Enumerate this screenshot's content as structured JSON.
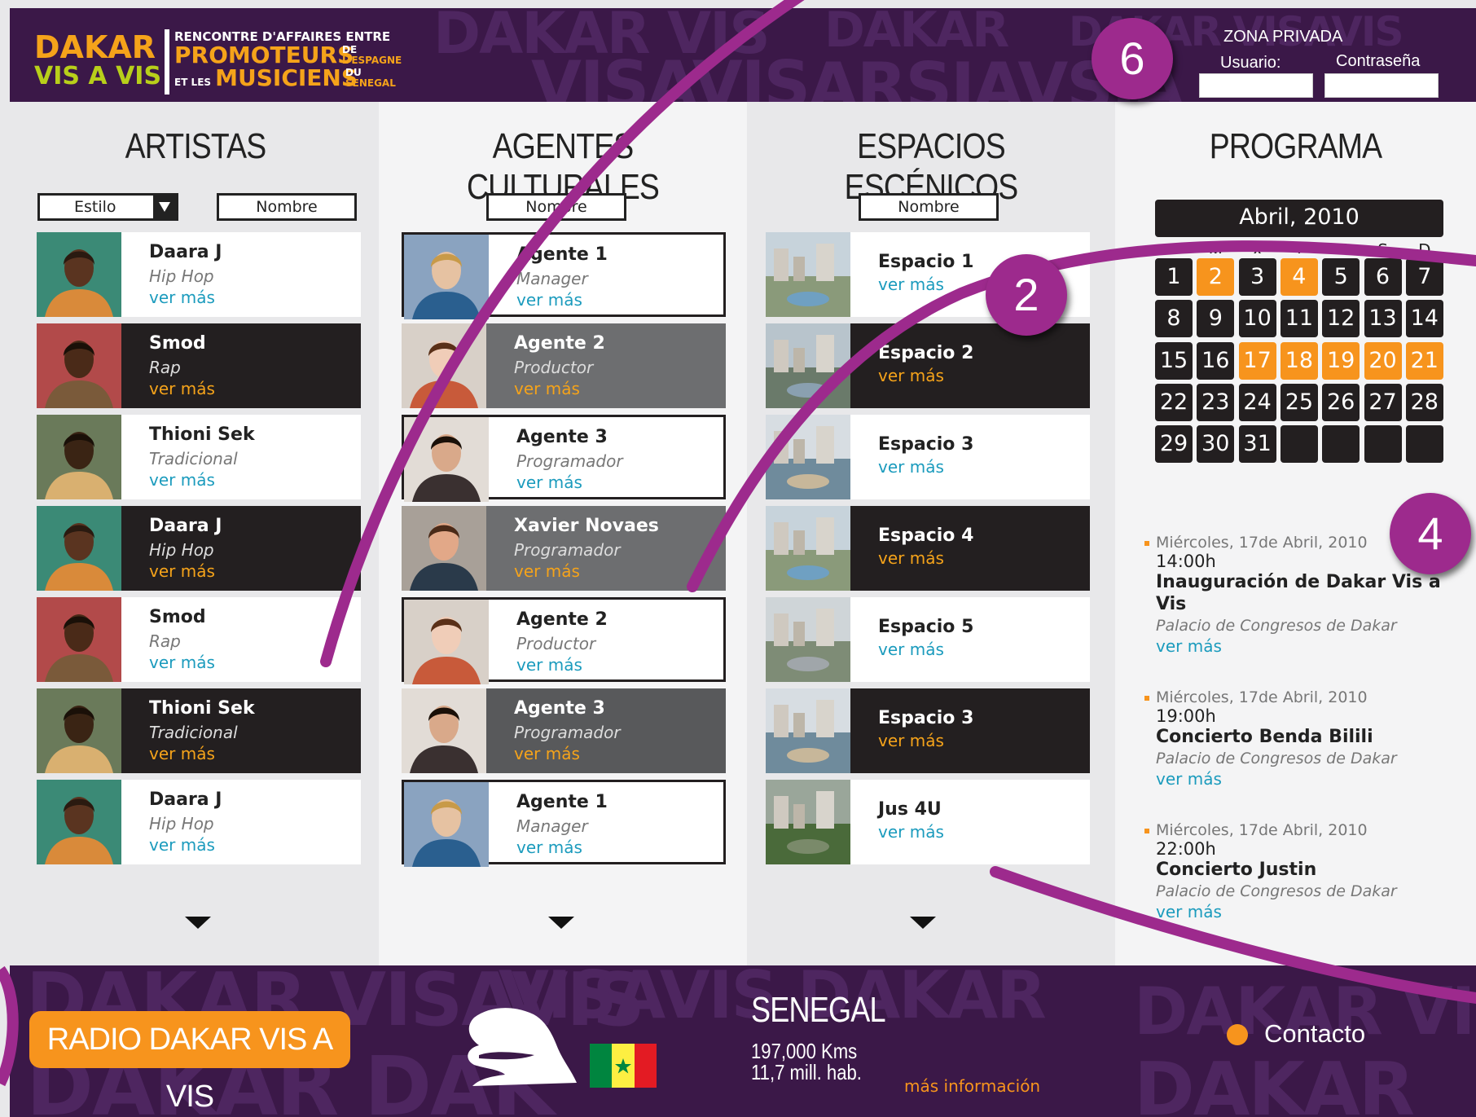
{
  "header": {
    "logo_line1": "DAKAR",
    "logo_line2": "VIS A VIS",
    "tagline_line1": "RENCONTRE D'AFFAIRES ENTRE",
    "tagline_promoteurs": "PROMOTEURS",
    "tagline_de": "DE",
    "tagline_espagne": "L'ESPAGNE",
    "tagline_et_les": "ET LES",
    "tagline_musiciens": "MUSICIENS",
    "tagline_du": "DU",
    "tagline_senegal": "SENEGAL",
    "zona_privada": "ZONA PRIVADA",
    "user_label": "Usuario:",
    "password_label": "Contraseña",
    "user_value": "",
    "password_value": ""
  },
  "artistas": {
    "title": "ARTISTAS",
    "filter_style": "Estilo",
    "filter_name": "Nombre",
    "items": [
      {
        "name": "Daara J",
        "role": "Hip Hop",
        "more": "ver más"
      },
      {
        "name": "Smod",
        "role": "Rap",
        "more": "ver más"
      },
      {
        "name": "Thioni Sek",
        "role": "Tradicional",
        "more": "ver más"
      },
      {
        "name": "Daara J",
        "role": "Hip Hop",
        "more": "ver más"
      },
      {
        "name": "Smod",
        "role": "Rap",
        "more": "ver más"
      },
      {
        "name": "Thioni Sek",
        "role": "Tradicional",
        "more": "ver más"
      },
      {
        "name": "Daara J",
        "role": "Hip Hop",
        "more": "ver más"
      }
    ]
  },
  "agentes": {
    "title": "AGENTES CULTURALES",
    "filter_name": "Nombre",
    "items": [
      {
        "name": "Agente 1",
        "role": "Manager",
        "more": "ver más"
      },
      {
        "name": "Agente 2",
        "role": "Productor",
        "more": "ver más"
      },
      {
        "name": "Agente 3",
        "role": "Programador",
        "more": "ver más"
      },
      {
        "name": "Xavier Novaes",
        "role": "Programador",
        "more": "ver más"
      },
      {
        "name": "Agente 2",
        "role": "Productor",
        "more": "ver más"
      },
      {
        "name": "Agente 3",
        "role": "Programador",
        "more": "ver más"
      },
      {
        "name": "Agente 1",
        "role": "Manager",
        "more": "ver más"
      }
    ]
  },
  "espacios": {
    "title": "ESPACIOS ESCÉNICOS",
    "filter_name": "Nombre",
    "items": [
      {
        "name": "Espacio 1",
        "more": "ver más"
      },
      {
        "name": "Espacio 2",
        "more": "ver más"
      },
      {
        "name": "Espacio 3",
        "more": "ver más"
      },
      {
        "name": "Espacio 4",
        "more": "ver más"
      },
      {
        "name": "Espacio 5",
        "more": "ver más"
      },
      {
        "name": "Espacio 3",
        "more": "ver más"
      },
      {
        "name": "Jus 4U",
        "more": "ver más"
      }
    ]
  },
  "programa": {
    "title": "PROGRAMA",
    "month": "Abril, 2010",
    "weekdays": [
      "L",
      "M",
      "X",
      "J",
      "V",
      "S",
      "D"
    ],
    "days": [
      "1",
      "2",
      "3",
      "4",
      "5",
      "6",
      "7",
      "8",
      "9",
      "10",
      "11",
      "12",
      "13",
      "14",
      "15",
      "16",
      "17",
      "18",
      "19",
      "20",
      "21",
      "22",
      "23",
      "24",
      "25",
      "26",
      "27",
      "28",
      "29",
      "30",
      "31",
      "",
      "",
      "",
      ""
    ],
    "highlighted_days": [
      "2",
      "4",
      "17",
      "18",
      "19",
      "20",
      "21"
    ],
    "events": [
      {
        "date": "Miércoles, 17de Abril, 2010",
        "time": "14:00h",
        "title": "Inauguración de Dakar Vis a Vis",
        "place": "Palacio de Congresos de Dakar",
        "more": "ver más"
      },
      {
        "date": "Miércoles, 17de Abril, 2010",
        "time": "19:00h",
        "title": "Concierto Benda Bilili",
        "place": "Palacio de Congresos de Dakar",
        "more": "ver más"
      },
      {
        "date": "Miércoles, 17de Abril, 2010",
        "time": "22:00h",
        "title": "Concierto Justin",
        "place": "Palacio de Congresos de Dakar",
        "more": "ver más"
      }
    ]
  },
  "footer": {
    "radio": "RADIO DAKAR VIS A VIS",
    "country": "SENEGAL",
    "area": "197,000 Kms",
    "population": "11,7 mill. hab.",
    "more_info": "más información",
    "contact": "Contacto"
  },
  "annotations": [
    "2",
    "4",
    "6"
  ],
  "colors": {
    "purple": "#3b1848",
    "orange": "#f7941d",
    "dark": "#231f20",
    "link": "#1b9bbd",
    "badge": "#9d2a8d"
  }
}
